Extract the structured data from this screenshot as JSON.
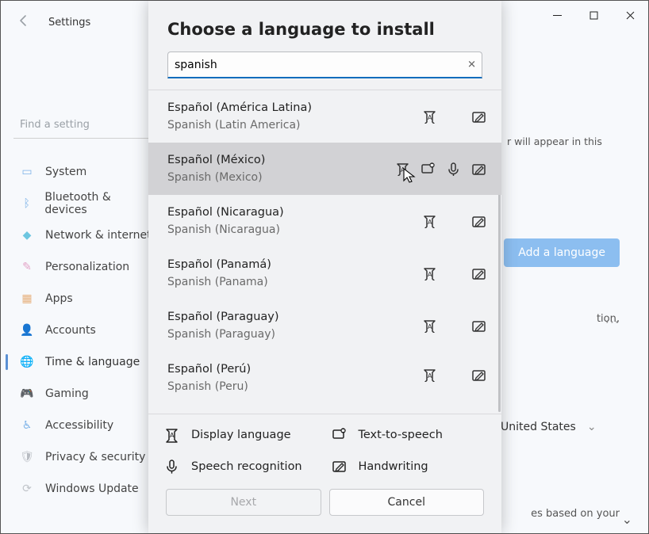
{
  "window": {
    "settings_title": "Settings",
    "find_placeholder": "Find a setting"
  },
  "sidebar": {
    "items": [
      {
        "label": "System"
      },
      {
        "label": "Bluetooth & devices"
      },
      {
        "label": "Network & internet"
      },
      {
        "label": "Personalization"
      },
      {
        "label": "Apps"
      },
      {
        "label": "Accounts"
      },
      {
        "label": "Time & language"
      },
      {
        "label": "Gaming"
      },
      {
        "label": "Accessibility"
      },
      {
        "label": "Privacy & security"
      },
      {
        "label": "Windows Update"
      }
    ]
  },
  "right": {
    "hint_text": "r will appear in this",
    "add_lang": "Add a language",
    "snippet2": "tion,",
    "more": "···",
    "region_value": "United States",
    "bottom_text": "es based on your"
  },
  "dialog": {
    "title": "Choose a language to install",
    "search_value": "spanish",
    "legend": {
      "display": "Display language",
      "tts": "Text-to-speech",
      "sr": "Speech recognition",
      "hw": "Handwriting"
    },
    "buttons": {
      "next": "Next",
      "cancel": "Cancel"
    },
    "results": [
      {
        "native": "Español (América Latina)",
        "english": "Spanish (Latin America)"
      },
      {
        "native": "Español (México)",
        "english": "Spanish (Mexico)"
      },
      {
        "native": "Español (Nicaragua)",
        "english": "Spanish (Nicaragua)"
      },
      {
        "native": "Español (Panamá)",
        "english": "Spanish (Panama)"
      },
      {
        "native": "Español (Paraguay)",
        "english": "Spanish (Paraguay)"
      },
      {
        "native": "Español (Perú)",
        "english": "Spanish (Peru)"
      }
    ]
  }
}
